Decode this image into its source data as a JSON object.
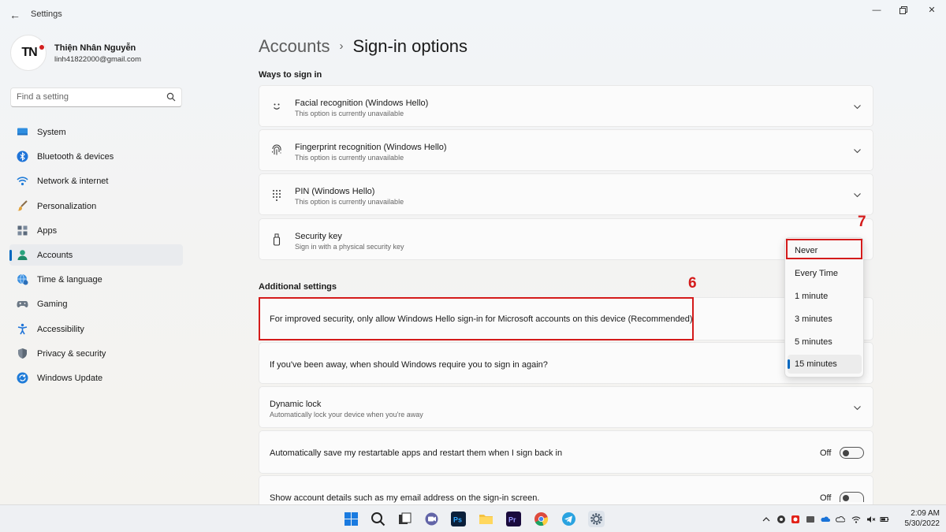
{
  "app": {
    "title": "Settings"
  },
  "profile": {
    "initials": "TN",
    "name": "Thiện Nhân Nguyễn",
    "email": "linh41822000@gmail.com"
  },
  "search": {
    "placeholder": "Find a setting"
  },
  "sidebar": {
    "items": [
      {
        "label": "System",
        "icon": "monitor-icon"
      },
      {
        "label": "Bluetooth & devices",
        "icon": "bluetooth-icon"
      },
      {
        "label": "Network & internet",
        "icon": "wifi-icon"
      },
      {
        "label": "Personalization",
        "icon": "brush-icon"
      },
      {
        "label": "Apps",
        "icon": "apps-icon"
      },
      {
        "label": "Accounts",
        "icon": "person-icon",
        "active": true
      },
      {
        "label": "Time & language",
        "icon": "globe-clock-icon"
      },
      {
        "label": "Gaming",
        "icon": "gamepad-icon"
      },
      {
        "label": "Accessibility",
        "icon": "accessibility-icon"
      },
      {
        "label": "Privacy & security",
        "icon": "shield-icon"
      },
      {
        "label": "Windows Update",
        "icon": "update-icon"
      }
    ]
  },
  "breadcrumb": {
    "parent": "Accounts",
    "separator": "›",
    "current": "Sign-in options"
  },
  "ways_to_sign_in": {
    "title": "Ways to sign in",
    "items": [
      {
        "title": "Facial recognition (Windows Hello)",
        "subtitle": "This option is currently unavailable",
        "icon": "face-icon"
      },
      {
        "title": "Fingerprint recognition (Windows Hello)",
        "subtitle": "This option is currently unavailable",
        "icon": "fingerprint-icon"
      },
      {
        "title": "PIN (Windows Hello)",
        "subtitle": "This option is currently unavailable",
        "icon": "keypad-icon"
      },
      {
        "title": "Security key",
        "subtitle": "Sign in with a physical security key",
        "icon": "usb-key-icon"
      }
    ]
  },
  "additional_settings": {
    "title": "Additional settings",
    "hello_only": "For improved security, only allow Windows Hello sign-in for Microsoft accounts on this device (Recommended)",
    "require_signin": "If you've been away, when should Windows require you to sign in again?",
    "dynamic_lock": {
      "title": "Dynamic lock",
      "subtitle": "Automatically lock your device when you're away"
    },
    "restart_apps": {
      "label": "Automatically save my restartable apps and restart them when I sign back in",
      "state": "Off"
    },
    "account_details": {
      "label": "Show account details such as my email address on the sign-in screen.",
      "state": "Off"
    }
  },
  "dropdown": {
    "options": [
      "Never",
      "Every Time",
      "1 minute",
      "3 minutes",
      "5 minutes",
      "15 minutes"
    ],
    "selected": "15 minutes"
  },
  "annotations": {
    "step6": "6",
    "step7": "7"
  },
  "taskbar": {
    "time": "2:09 AM",
    "date": "5/30/2022",
    "apps": [
      "windows-start-icon",
      "search-icon",
      "task-view-icon",
      "chat-icon",
      "photoshop-icon",
      "file-explorer-icon",
      "premiere-icon",
      "chrome-icon",
      "telegram-icon",
      "settings-icon"
    ]
  },
  "colors": {
    "accent": "#0067c0",
    "annotation": "#d41b1b"
  }
}
